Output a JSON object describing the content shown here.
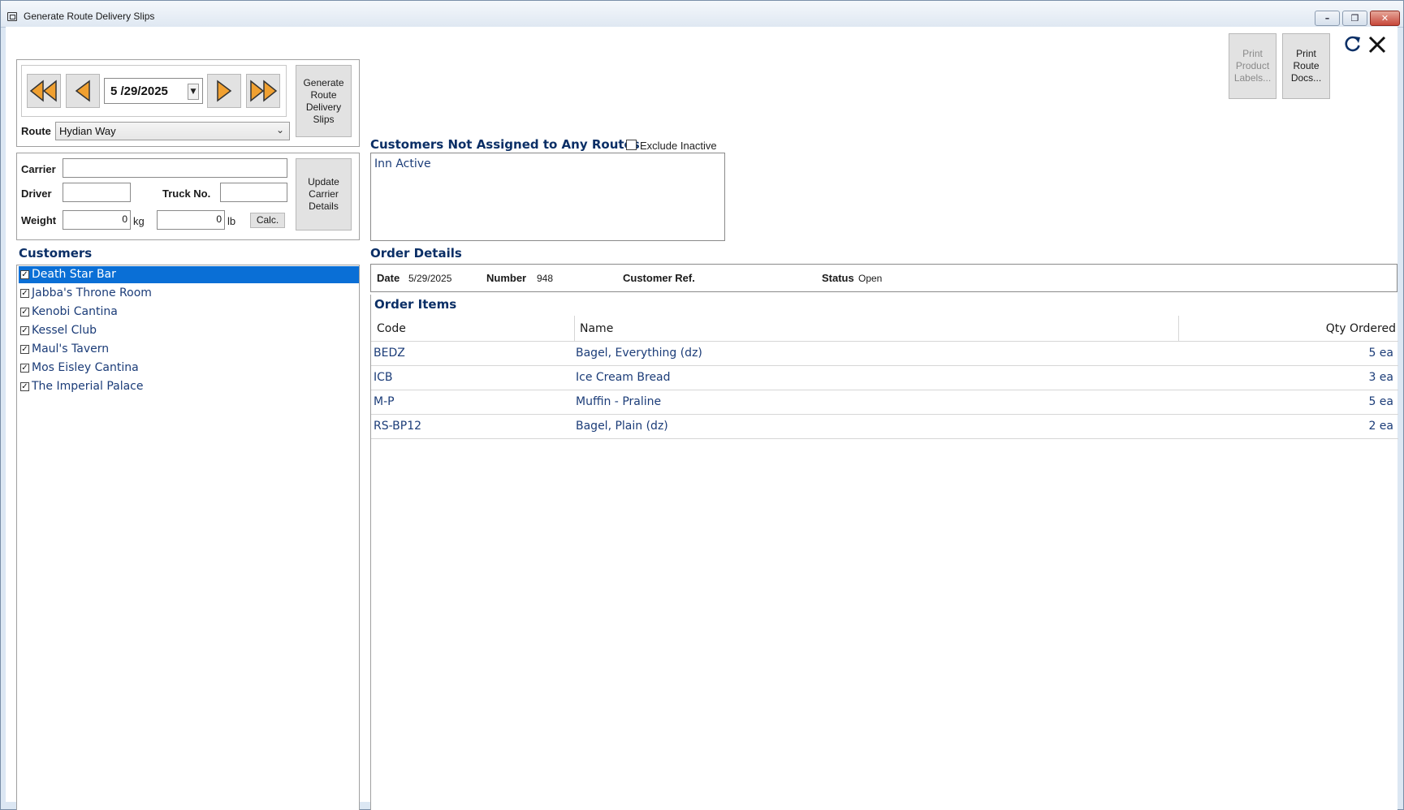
{
  "window": {
    "title": "Generate Route Delivery Slips"
  },
  "navigation": {
    "date": "5 /29/2025",
    "generate_button": "Generate\nRoute\nDelivery\nSlips",
    "route_label": "Route",
    "route_value": "Hydian Way"
  },
  "carrier_panel": {
    "carrier_label": "Carrier",
    "carrier_value": "",
    "driver_label": "Driver",
    "driver_value": "",
    "truck_label": "Truck No.",
    "truck_value": "",
    "weight_label": "Weight",
    "weight_kg": "0",
    "kg_unit": "kg",
    "weight_lb": "0",
    "lb_unit": "lb",
    "calc_button": "Calc.",
    "update_button": "Update\nCarrier\nDetails"
  },
  "toolbar": {
    "print_labels": "Print\nProduct\nLabels...",
    "print_docs": "Print\nRoute\nDocs...",
    "print_labels_enabled": false
  },
  "unassigned": {
    "header": "Customers Not Assigned to Any Routes",
    "exclude_inactive_label": "Exclude Inactive",
    "exclude_inactive_checked": false,
    "items": [
      "Inn Active"
    ]
  },
  "customers": {
    "header": "Customers",
    "selected_index": 0,
    "items": [
      {
        "name": "Death Star Bar",
        "checked": true
      },
      {
        "name": "Jabba's Throne Room",
        "checked": true
      },
      {
        "name": "Kenobi Cantina",
        "checked": true
      },
      {
        "name": "Kessel Club",
        "checked": true
      },
      {
        "name": "Maul's Tavern",
        "checked": true
      },
      {
        "name": "Mos Eisley Cantina",
        "checked": true
      },
      {
        "name": "The Imperial Palace",
        "checked": true
      }
    ]
  },
  "order_details": {
    "header": "Order Details",
    "date_label": "Date",
    "date_value": "5/29/2025",
    "number_label": "Number",
    "number_value": "948",
    "custref_label": "Customer Ref.",
    "custref_value": "",
    "status_label": "Status",
    "status_value": "Open"
  },
  "order_items": {
    "header": "Order Items",
    "columns": [
      "Code",
      "Name",
      "Qty Ordered"
    ],
    "rows": [
      {
        "code": "BEDZ",
        "name": "Bagel, Everything (dz)",
        "qty": "5 ea"
      },
      {
        "code": "ICB",
        "name": "Ice Cream Bread",
        "qty": "3 ea"
      },
      {
        "code": "M-P",
        "name": "Muffin - Praline",
        "qty": "5 ea"
      },
      {
        "code": "RS-BP12",
        "name": "Bagel, Plain (dz)",
        "qty": "2 ea"
      }
    ]
  },
  "colors": {
    "accent": "#0a6fd6",
    "header_text": "#0b2f66",
    "nav_arrow": "#f0a030"
  }
}
